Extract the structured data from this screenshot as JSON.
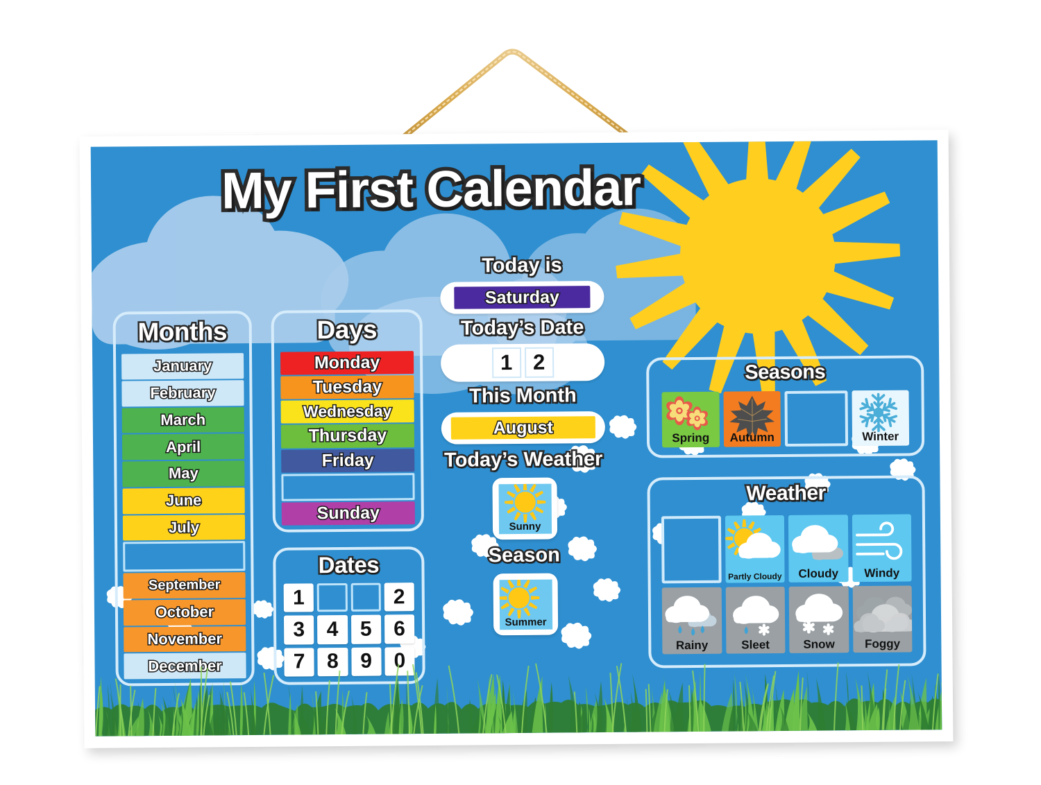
{
  "title": "My First Calendar",
  "colors": {
    "sky": "#2f8fd0",
    "cloud": "#a9cdec",
    "sun": "#ffce1f",
    "panel_border": "#d6ecfb",
    "grass_light": "#6cc24a",
    "grass_dark": "#2e7d32"
  },
  "months_panel": {
    "title": "Months",
    "items": [
      {
        "label": "January",
        "color": "#cfe8f8",
        "empty": false
      },
      {
        "label": "February",
        "color": "#cfe8f8",
        "empty": false
      },
      {
        "label": "March",
        "color": "#4eb24e",
        "empty": false
      },
      {
        "label": "April",
        "color": "#4eb24e",
        "empty": false
      },
      {
        "label": "May",
        "color": "#4eb24e",
        "empty": false
      },
      {
        "label": "June",
        "color": "#ffd21a",
        "empty": false
      },
      {
        "label": "July",
        "color": "#ffd21a",
        "empty": false
      },
      {
        "label": "",
        "color": "#2f8fd0",
        "empty": true
      },
      {
        "label": "September",
        "color": "#f7962b",
        "empty": false
      },
      {
        "label": "October",
        "color": "#f7962b",
        "empty": false
      },
      {
        "label": "November",
        "color": "#f7962b",
        "empty": false
      },
      {
        "label": "December",
        "color": "#cfe8f8",
        "empty": false
      }
    ]
  },
  "days_panel": {
    "title": "Days",
    "items": [
      {
        "label": "Monday",
        "color": "#ee2222",
        "empty": false
      },
      {
        "label": "Tuesday",
        "color": "#f7941e",
        "empty": false
      },
      {
        "label": "Wednesday",
        "color": "#fbe31b",
        "empty": false
      },
      {
        "label": "Thursday",
        "color": "#6cbe3c",
        "empty": false
      },
      {
        "label": "Friday",
        "color": "#41599f",
        "empty": false
      },
      {
        "label": "",
        "color": "#2f8fd0",
        "empty": true
      },
      {
        "label": "Sunday",
        "color": "#b03fa8",
        "empty": false
      }
    ]
  },
  "dates_panel": {
    "title": "Dates",
    "cells": [
      {
        "label": "1",
        "empty": false
      },
      {
        "label": "",
        "empty": true
      },
      {
        "label": "",
        "empty": true
      },
      {
        "label": "2",
        "empty": false
      },
      {
        "label": "3",
        "empty": false
      },
      {
        "label": "4",
        "empty": false
      },
      {
        "label": "5",
        "empty": false
      },
      {
        "label": "6",
        "empty": false
      },
      {
        "label": "7",
        "empty": false
      },
      {
        "label": "8",
        "empty": false
      },
      {
        "label": "9",
        "empty": false
      },
      {
        "label": "0",
        "empty": false
      }
    ]
  },
  "today": {
    "today_is_label": "Today is",
    "today_is_value": "Saturday",
    "today_is_color": "#4a2a9e",
    "date_label": "Today’s Date",
    "date_digits": [
      "1",
      "2"
    ],
    "month_label": "This Month",
    "month_value": "August",
    "month_color": "#ffd21a",
    "weather_label": "Today’s Weather",
    "weather_value": "Sunny",
    "weather_icon": "sun-icon",
    "season_label": "Season",
    "season_value": "Summer",
    "season_icon": "sun-icon"
  },
  "seasons_panel": {
    "title": "Seasons",
    "items": [
      {
        "label": "Spring",
        "bg": "#79c943",
        "icon": "flowers-icon",
        "empty": false
      },
      {
        "label": "Autumn",
        "bg": "#f37c20",
        "icon": "maple-leaf-icon",
        "empty": false
      },
      {
        "label": "",
        "bg": "#2f8fd0",
        "icon": "empty-slot",
        "empty": true
      },
      {
        "label": "Winter",
        "bg": "#e8f6fd",
        "icon": "snowflake-icon",
        "empty": false
      }
    ]
  },
  "weather_panel": {
    "title": "Weather",
    "items": [
      {
        "label": "",
        "bg": "#2f8fd0",
        "icon": "empty-slot",
        "empty": true
      },
      {
        "label": "Partly Cloudy",
        "bg": "#5ec8f0",
        "icon": "sun-behind-cloud-icon",
        "empty": false
      },
      {
        "label": "Cloudy",
        "bg": "#5ec8f0",
        "icon": "cloud-icon",
        "empty": false
      },
      {
        "label": "Windy",
        "bg": "#5ec8f0",
        "icon": "wind-icon",
        "empty": false
      },
      {
        "label": "Rainy",
        "bg": "#9aa0a4",
        "icon": "rain-cloud-icon",
        "empty": false
      },
      {
        "label": "Sleet",
        "bg": "#9aa0a4",
        "icon": "sleet-cloud-icon",
        "empty": false
      },
      {
        "label": "Snow",
        "bg": "#9aa0a4",
        "icon": "snow-cloud-icon",
        "empty": false
      },
      {
        "label": "Foggy",
        "bg": "#9aa0a4",
        "icon": "fog-icon",
        "empty": false
      }
    ]
  }
}
